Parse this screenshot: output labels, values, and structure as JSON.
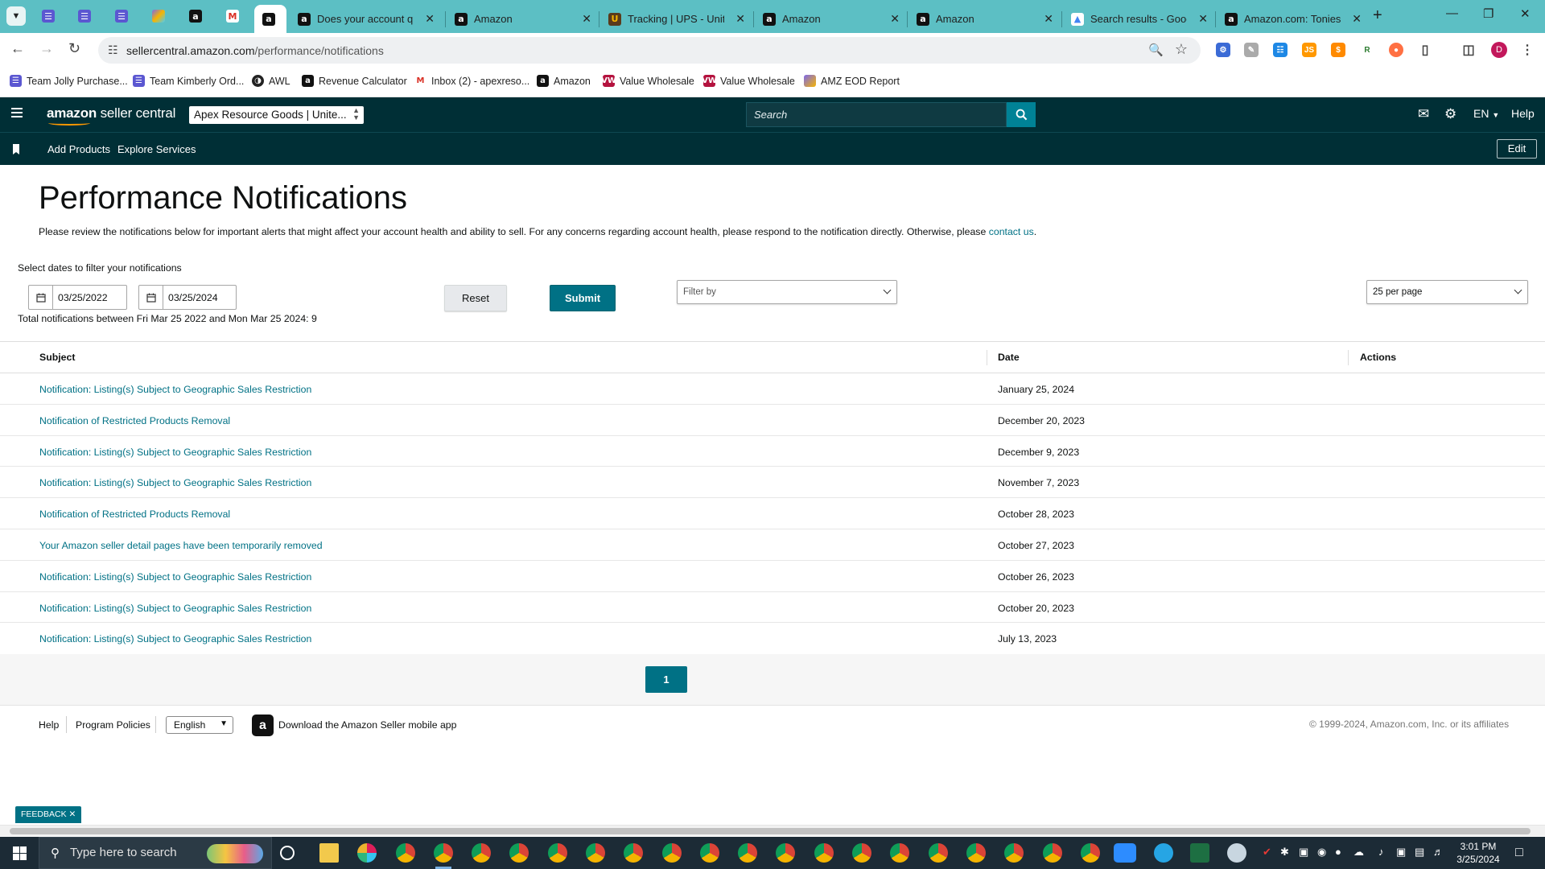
{
  "browser": {
    "tabs": [
      {
        "title": "Does your account qu",
        "favicon": "amazon-icon",
        "active": false
      },
      {
        "title": "Amazon",
        "favicon": "amazon-icon",
        "active": false
      },
      {
        "title": "Tracking | UPS - United",
        "favicon": "ups-icon",
        "active": false
      },
      {
        "title": "Amazon",
        "favicon": "amazon-icon",
        "active": false
      },
      {
        "title": "Amazon",
        "favicon": "amazon-icon",
        "active": false
      },
      {
        "title": "Search results - Googl",
        "favicon": "google-drive-icon",
        "active": false
      },
      {
        "title": "Amazon.com: Tonies A",
        "favicon": "amazon-icon",
        "active": false
      }
    ],
    "url_domain": "sellercentral.amazon.com",
    "url_path": "/performance/notifications",
    "profile_initial": "D",
    "bookmarks": [
      {
        "label": "Team Jolly Purchase...",
        "icon": "list-icon"
      },
      {
        "label": "Team Kimberly Ord...",
        "icon": "list-icon"
      },
      {
        "label": "AWL",
        "icon": "awl-icon"
      },
      {
        "label": "Revenue Calculator",
        "icon": "amazon-icon"
      },
      {
        "label": "Inbox (2) - apexreso...",
        "icon": "gmail-icon"
      },
      {
        "label": "Amazon",
        "icon": "amazon-icon"
      },
      {
        "label": "Value Wholesale",
        "icon": "vw-icon"
      },
      {
        "label": "Value Wholesale",
        "icon": "vw-icon"
      },
      {
        "label": "AMZ EOD Report",
        "icon": "clickup-icon"
      }
    ]
  },
  "header": {
    "logo_main": "amazon",
    "logo_sub": "seller central",
    "account": "Apex Resource Goods | Unite...",
    "search_placeholder": "Search",
    "lang": "EN",
    "help": "Help",
    "nav": [
      "Add Products",
      "Explore Services"
    ],
    "edit": "Edit"
  },
  "page": {
    "title": "Performance Notifications",
    "description": "Please review the notifications below for important alerts that might affect your account health and ability to sell. For any concerns regarding account health, please respond to the notification directly. Otherwise, please",
    "contact_link": "contact us",
    "period": ".",
    "date_hint": "Select dates to filter your notifications",
    "start_date": "03/25/2022",
    "end_date": "03/25/2024",
    "total": "Total notifications between Fri Mar 25 2022 and Mon Mar 25 2024: 9",
    "reset": "Reset",
    "submit": "Submit",
    "filter_placeholder": "Filter by",
    "per_page": "25 per page"
  },
  "table": {
    "headers": {
      "subject": "Subject",
      "date": "Date",
      "actions": "Actions"
    },
    "rows": [
      {
        "subject": "Notification: Listing(s) Subject to Geographic Sales Restriction",
        "date": "January 25, 2024"
      },
      {
        "subject": "Notification of Restricted Products Removal",
        "date": "December 20, 2023"
      },
      {
        "subject": "Notification: Listing(s) Subject to Geographic Sales Restriction",
        "date": "December 9, 2023"
      },
      {
        "subject": "Notification: Listing(s) Subject to Geographic Sales Restriction",
        "date": "November 7, 2023"
      },
      {
        "subject": "Notification of Restricted Products Removal",
        "date": "October 28, 2023"
      },
      {
        "subject": "Your Amazon seller detail pages have been temporarily removed",
        "date": "October 27, 2023"
      },
      {
        "subject": "Notification: Listing(s) Subject to Geographic Sales Restriction",
        "date": "October 26, 2023"
      },
      {
        "subject": "Notification: Listing(s) Subject to Geographic Sales Restriction",
        "date": "October 20, 2023"
      },
      {
        "subject": "Notification: Listing(s) Subject to Geographic Sales Restriction",
        "date": "July 13, 2023"
      }
    ]
  },
  "pagination": {
    "current": "1"
  },
  "footer": {
    "help": "Help",
    "policies": "Program Policies",
    "language": "English",
    "app_text": "Download the Amazon Seller mobile app",
    "copyright": "© 1999-2024, Amazon.com, Inc. or its affiliates"
  },
  "feedback": "FEEDBACK",
  "taskbar": {
    "search_placeholder": "Type here to search",
    "time": "3:01 PM",
    "date": "3/25/2024"
  },
  "colors": {
    "teal_link": "#007185",
    "header_bg": "#002f36",
    "tab_strip": "#5cbfc4",
    "button_teal": "#008296"
  }
}
